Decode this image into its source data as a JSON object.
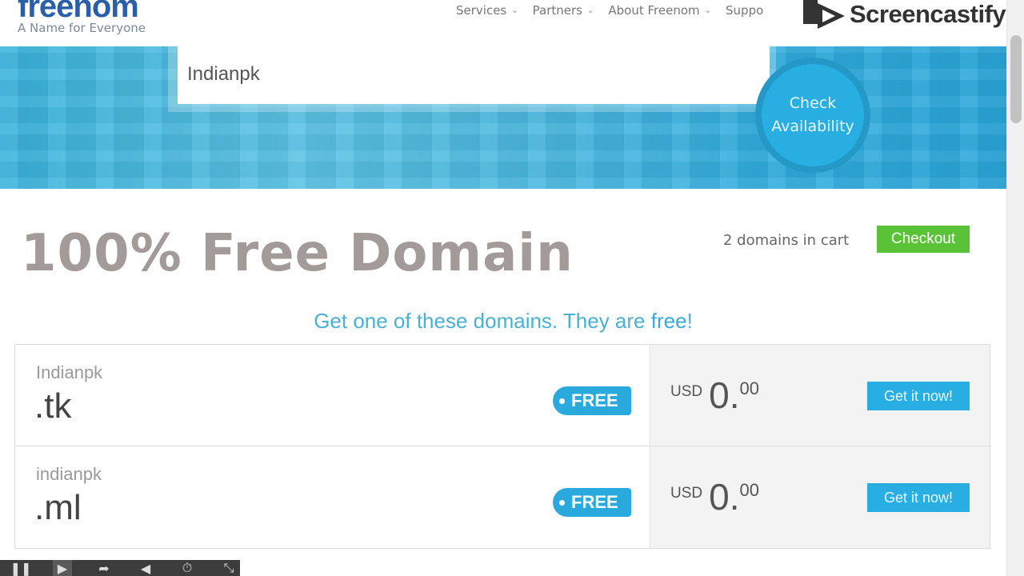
{
  "header": {
    "logo": "freenom",
    "tagline": "A Name for Everyone",
    "nav": [
      {
        "label": "Services"
      },
      {
        "label": "Partners"
      },
      {
        "label": "About Freenom"
      },
      {
        "label": "Suppo"
      }
    ]
  },
  "watermark": {
    "label": "Screencastify"
  },
  "search": {
    "value": "Indianpk",
    "button_line1": "Check",
    "button_line2": "Availability"
  },
  "main": {
    "headline": "100% Free Domain",
    "cart_count": "2 domains in cart",
    "checkout_label": "Checkout",
    "subtitle_prefix": "Get one of these domains. They are ",
    "subtitle_emph": "free",
    "subtitle_suffix": "!"
  },
  "domains": [
    {
      "name": "Indianpk",
      "tld": ".tk",
      "badge": "FREE",
      "currency": "USD",
      "amount": "0.",
      "cents": "00",
      "button": "Get it now!"
    },
    {
      "name": "indianpk",
      "tld": ".ml",
      "badge": "FREE",
      "currency": "USD",
      "amount": "0.",
      "cents": "00",
      "button": "Get it now!"
    }
  ],
  "colors": {
    "brand_blue": "#28aee0",
    "checkout_green": "#5ac236",
    "headline_gray": "#a39b99"
  }
}
